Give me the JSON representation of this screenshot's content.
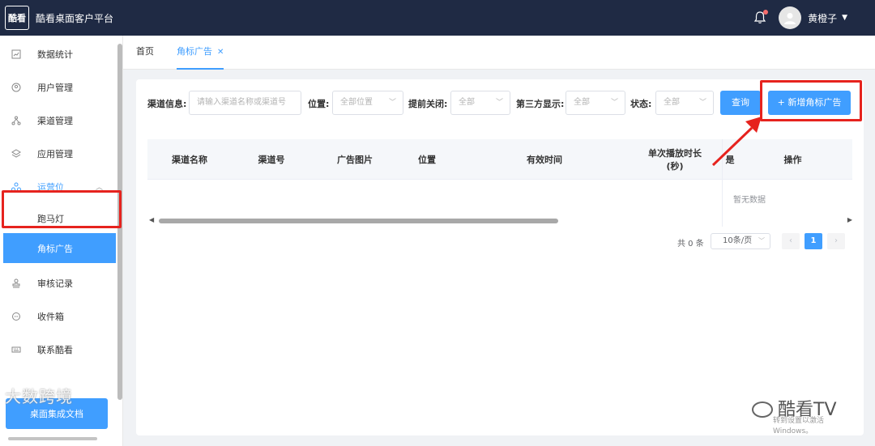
{
  "header": {
    "logo_text": "酷看",
    "title": "酷看桌面客户平台",
    "username": "黄橙子"
  },
  "sidebar": {
    "items": [
      {
        "label": "数据统计"
      },
      {
        "label": "用户管理"
      },
      {
        "label": "渠道管理"
      },
      {
        "label": "应用管理"
      },
      {
        "label": "运营位"
      },
      {
        "label": "跑马灯"
      },
      {
        "label": "角标广告"
      },
      {
        "label": "审核记录"
      },
      {
        "label": "收件箱"
      },
      {
        "label": "联系酷看"
      }
    ],
    "doc_button": "桌面集成文档"
  },
  "tabs": [
    {
      "label": "首页"
    },
    {
      "label": "角标广告"
    }
  ],
  "filters": {
    "channel_label": "渠道信息:",
    "channel_placeholder": "请输入渠道名称或渠道号",
    "position_label": "位置:",
    "position_value": "全部位置",
    "close_label": "提前关闭:",
    "close_value": "全部",
    "third_label": "第三方显示:",
    "third_value": "全部",
    "status_label": "状态:",
    "status_value": "全部",
    "query_button": "查询",
    "add_button": "+ 新增角标广告"
  },
  "table": {
    "columns": [
      "渠道名称",
      "渠道号",
      "广告图片",
      "位置",
      "有效时间",
      "单次播放时长\n(秒)",
      "是",
      "操作"
    ],
    "empty_text": "暂无数据"
  },
  "pagination": {
    "total": "共 0 条",
    "page_size": "10条/页",
    "current_page": "1"
  },
  "watermarks": {
    "left": "大数跨境",
    "right_big": "酷看TV",
    "right_small": "转到设置以激活 Windows。"
  },
  "colors": {
    "primary": "#409eff",
    "header_bg": "#1f2a44",
    "highlight_red": "#e6231e"
  }
}
